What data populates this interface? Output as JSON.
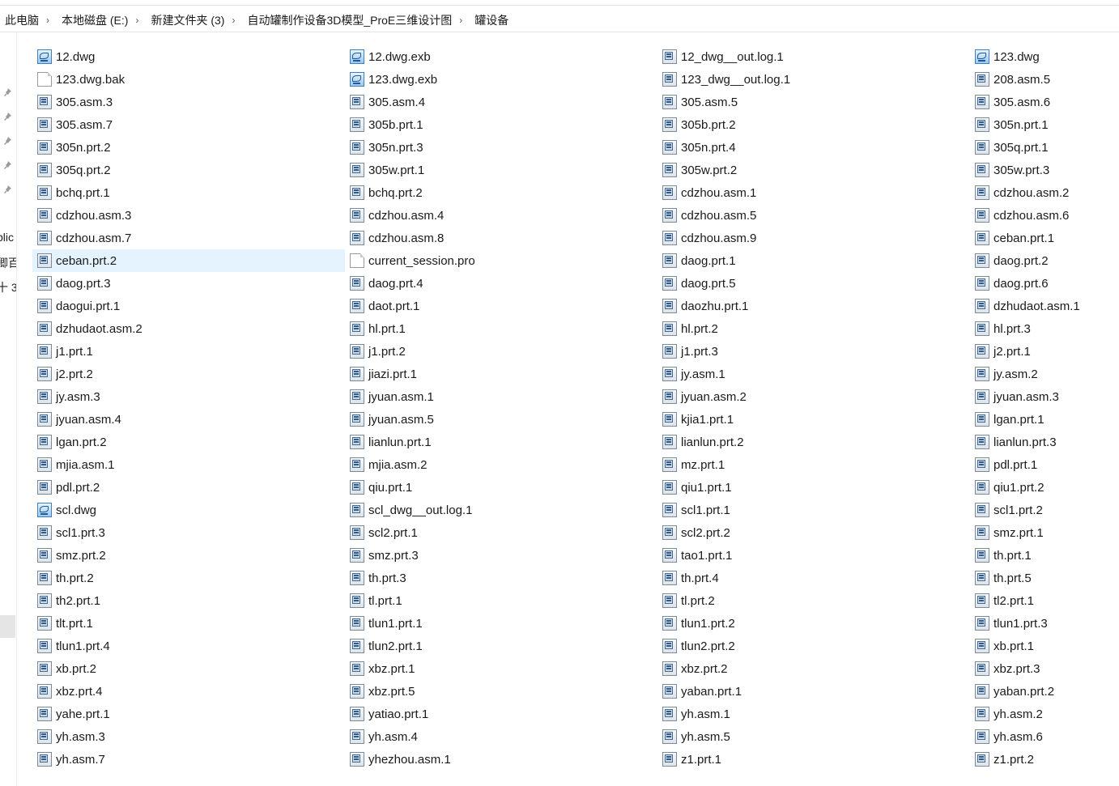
{
  "breadcrumb": [
    "此电脑",
    "本地磁盘 (E:)",
    "新建文件夹 (3)",
    "自动罐制作设备3D模型_ProE三维设计图",
    "罐设备"
  ],
  "breadcrumb_separator": "›",
  "nav_pins": [
    "pin-icon",
    "pin-icon",
    "pin-icon",
    "pin-icon",
    "pin-icon"
  ],
  "nav_partial": [
    "blic",
    "卿百",
    "十 3"
  ],
  "colors": {
    "selected_bg": "#e5f3ff",
    "nav_selected": "#e5e5e5"
  },
  "selected_item": "ceban.prt.2",
  "files": [
    {
      "name": "12.dwg",
      "icon": "dwg"
    },
    {
      "name": "12.dwg.exb",
      "icon": "dwg"
    },
    {
      "name": "12_dwg__out.log.1",
      "icon": "gen"
    },
    {
      "name": "123.dwg",
      "icon": "dwg"
    },
    {
      "name": "123.dwg.bak",
      "icon": "blank"
    },
    {
      "name": "123.dwg.exb",
      "icon": "dwg"
    },
    {
      "name": "123_dwg__out.log.1",
      "icon": "gen"
    },
    {
      "name": "208.asm.5",
      "icon": "gen"
    },
    {
      "name": "305.asm.3",
      "icon": "gen"
    },
    {
      "name": "305.asm.4",
      "icon": "gen"
    },
    {
      "name": "305.asm.5",
      "icon": "gen"
    },
    {
      "name": "305.asm.6",
      "icon": "gen"
    },
    {
      "name": "305.asm.7",
      "icon": "gen"
    },
    {
      "name": "305b.prt.1",
      "icon": "gen"
    },
    {
      "name": "305b.prt.2",
      "icon": "gen"
    },
    {
      "name": "305n.prt.1",
      "icon": "gen"
    },
    {
      "name": "305n.prt.2",
      "icon": "gen"
    },
    {
      "name": "305n.prt.3",
      "icon": "gen"
    },
    {
      "name": "305n.prt.4",
      "icon": "gen"
    },
    {
      "name": "305q.prt.1",
      "icon": "gen"
    },
    {
      "name": "305q.prt.2",
      "icon": "gen"
    },
    {
      "name": "305w.prt.1",
      "icon": "gen"
    },
    {
      "name": "305w.prt.2",
      "icon": "gen"
    },
    {
      "name": "305w.prt.3",
      "icon": "gen"
    },
    {
      "name": "bchq.prt.1",
      "icon": "gen"
    },
    {
      "name": "bchq.prt.2",
      "icon": "gen"
    },
    {
      "name": "cdzhou.asm.1",
      "icon": "gen"
    },
    {
      "name": "cdzhou.asm.2",
      "icon": "gen"
    },
    {
      "name": "cdzhou.asm.3",
      "icon": "gen"
    },
    {
      "name": "cdzhou.asm.4",
      "icon": "gen"
    },
    {
      "name": "cdzhou.asm.5",
      "icon": "gen"
    },
    {
      "name": "cdzhou.asm.6",
      "icon": "gen"
    },
    {
      "name": "cdzhou.asm.7",
      "icon": "gen"
    },
    {
      "name": "cdzhou.asm.8",
      "icon": "gen"
    },
    {
      "name": "cdzhou.asm.9",
      "icon": "gen"
    },
    {
      "name": "ceban.prt.1",
      "icon": "gen"
    },
    {
      "name": "ceban.prt.2",
      "icon": "gen"
    },
    {
      "name": "current_session.pro",
      "icon": "blank"
    },
    {
      "name": "daog.prt.1",
      "icon": "gen"
    },
    {
      "name": "daog.prt.2",
      "icon": "gen"
    },
    {
      "name": "daog.prt.3",
      "icon": "gen"
    },
    {
      "name": "daog.prt.4",
      "icon": "gen"
    },
    {
      "name": "daog.prt.5",
      "icon": "gen"
    },
    {
      "name": "daog.prt.6",
      "icon": "gen"
    },
    {
      "name": "daogui.prt.1",
      "icon": "gen"
    },
    {
      "name": "daot.prt.1",
      "icon": "gen"
    },
    {
      "name": "daozhu.prt.1",
      "icon": "gen"
    },
    {
      "name": "dzhudaot.asm.1",
      "icon": "gen"
    },
    {
      "name": "dzhudaot.asm.2",
      "icon": "gen"
    },
    {
      "name": "hl.prt.1",
      "icon": "gen"
    },
    {
      "name": "hl.prt.2",
      "icon": "gen"
    },
    {
      "name": "hl.prt.3",
      "icon": "gen"
    },
    {
      "name": "j1.prt.1",
      "icon": "gen"
    },
    {
      "name": "j1.prt.2",
      "icon": "gen"
    },
    {
      "name": "j1.prt.3",
      "icon": "gen"
    },
    {
      "name": "j2.prt.1",
      "icon": "gen"
    },
    {
      "name": "j2.prt.2",
      "icon": "gen"
    },
    {
      "name": "jiazi.prt.1",
      "icon": "gen"
    },
    {
      "name": "jy.asm.1",
      "icon": "gen"
    },
    {
      "name": "jy.asm.2",
      "icon": "gen"
    },
    {
      "name": "jy.asm.3",
      "icon": "gen"
    },
    {
      "name": "jyuan.asm.1",
      "icon": "gen"
    },
    {
      "name": "jyuan.asm.2",
      "icon": "gen"
    },
    {
      "name": "jyuan.asm.3",
      "icon": "gen"
    },
    {
      "name": "jyuan.asm.4",
      "icon": "gen"
    },
    {
      "name": "jyuan.asm.5",
      "icon": "gen"
    },
    {
      "name": "kjia1.prt.1",
      "icon": "gen"
    },
    {
      "name": "lgan.prt.1",
      "icon": "gen"
    },
    {
      "name": "lgan.prt.2",
      "icon": "gen"
    },
    {
      "name": "lianlun.prt.1",
      "icon": "gen"
    },
    {
      "name": "lianlun.prt.2",
      "icon": "gen"
    },
    {
      "name": "lianlun.prt.3",
      "icon": "gen"
    },
    {
      "name": "mjia.asm.1",
      "icon": "gen"
    },
    {
      "name": "mjia.asm.2",
      "icon": "gen"
    },
    {
      "name": "mz.prt.1",
      "icon": "gen"
    },
    {
      "name": "pdl.prt.1",
      "icon": "gen"
    },
    {
      "name": "pdl.prt.2",
      "icon": "gen"
    },
    {
      "name": "qiu.prt.1",
      "icon": "gen"
    },
    {
      "name": "qiu1.prt.1",
      "icon": "gen"
    },
    {
      "name": "qiu1.prt.2",
      "icon": "gen"
    },
    {
      "name": "scl.dwg",
      "icon": "dwg"
    },
    {
      "name": "scl_dwg__out.log.1",
      "icon": "gen"
    },
    {
      "name": "scl1.prt.1",
      "icon": "gen"
    },
    {
      "name": "scl1.prt.2",
      "icon": "gen"
    },
    {
      "name": "scl1.prt.3",
      "icon": "gen"
    },
    {
      "name": "scl2.prt.1",
      "icon": "gen"
    },
    {
      "name": "scl2.prt.2",
      "icon": "gen"
    },
    {
      "name": "smz.prt.1",
      "icon": "gen"
    },
    {
      "name": "smz.prt.2",
      "icon": "gen"
    },
    {
      "name": "smz.prt.3",
      "icon": "gen"
    },
    {
      "name": "tao1.prt.1",
      "icon": "gen"
    },
    {
      "name": "th.prt.1",
      "icon": "gen"
    },
    {
      "name": "th.prt.2",
      "icon": "gen"
    },
    {
      "name": "th.prt.3",
      "icon": "gen"
    },
    {
      "name": "th.prt.4",
      "icon": "gen"
    },
    {
      "name": "th.prt.5",
      "icon": "gen"
    },
    {
      "name": "th2.prt.1",
      "icon": "gen"
    },
    {
      "name": "tl.prt.1",
      "icon": "gen"
    },
    {
      "name": "tl.prt.2",
      "icon": "gen"
    },
    {
      "name": "tl2.prt.1",
      "icon": "gen"
    },
    {
      "name": "tlt.prt.1",
      "icon": "gen"
    },
    {
      "name": "tlun1.prt.1",
      "icon": "gen"
    },
    {
      "name": "tlun1.prt.2",
      "icon": "gen"
    },
    {
      "name": "tlun1.prt.3",
      "icon": "gen"
    },
    {
      "name": "tlun1.prt.4",
      "icon": "gen"
    },
    {
      "name": "tlun2.prt.1",
      "icon": "gen"
    },
    {
      "name": "tlun2.prt.2",
      "icon": "gen"
    },
    {
      "name": "xb.prt.1",
      "icon": "gen"
    },
    {
      "name": "xb.prt.2",
      "icon": "gen"
    },
    {
      "name": "xbz.prt.1",
      "icon": "gen"
    },
    {
      "name": "xbz.prt.2",
      "icon": "gen"
    },
    {
      "name": "xbz.prt.3",
      "icon": "gen"
    },
    {
      "name": "xbz.prt.4",
      "icon": "gen"
    },
    {
      "name": "xbz.prt.5",
      "icon": "gen"
    },
    {
      "name": "yaban.prt.1",
      "icon": "gen"
    },
    {
      "name": "yaban.prt.2",
      "icon": "gen"
    },
    {
      "name": "yahe.prt.1",
      "icon": "gen"
    },
    {
      "name": "yatiao.prt.1",
      "icon": "gen"
    },
    {
      "name": "yh.asm.1",
      "icon": "gen"
    },
    {
      "name": "yh.asm.2",
      "icon": "gen"
    },
    {
      "name": "yh.asm.3",
      "icon": "gen"
    },
    {
      "name": "yh.asm.4",
      "icon": "gen"
    },
    {
      "name": "yh.asm.5",
      "icon": "gen"
    },
    {
      "name": "yh.asm.6",
      "icon": "gen"
    },
    {
      "name": "yh.asm.7",
      "icon": "gen"
    },
    {
      "name": "yhezhou.asm.1",
      "icon": "gen"
    },
    {
      "name": "z1.prt.1",
      "icon": "gen"
    },
    {
      "name": "z1.prt.2",
      "icon": "gen"
    }
  ]
}
